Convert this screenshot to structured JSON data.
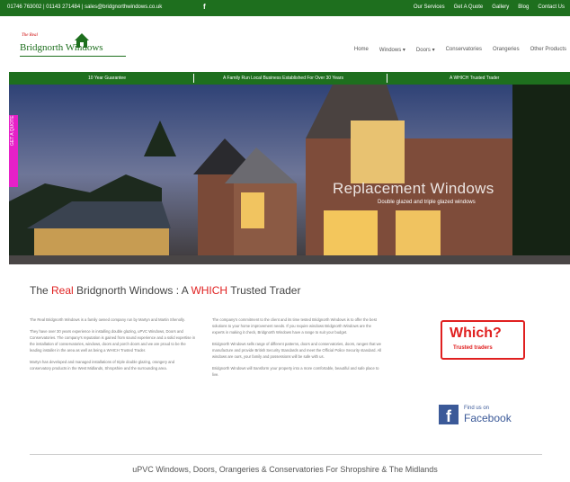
{
  "topbar": {
    "contact": "01746 763002 | 01143 271484 | sales@bridgnorthwindows.co.uk",
    "links": [
      "Our Services",
      "Get A Quote",
      "Gallery",
      "Blog",
      "Contact Us"
    ]
  },
  "header": {
    "logo_small": "The Real",
    "logo_name": "Bridgnorth Windows",
    "nav": [
      "Home",
      "Windows ▾",
      "Doors ▾",
      "Conservatories",
      "Orangeries",
      "Other Products"
    ]
  },
  "usp_bar": [
    "10 Year Guarantee",
    "A Family Run Local Business Established For Over 30 Years",
    "A WHICH Trusted Trader"
  ],
  "hero": {
    "caption": "Replacement Windows",
    "subcaption": "Double glazed and triple glazed windows"
  },
  "quote_tab": "GET A QUOTE",
  "main": {
    "title_prefix": "The ",
    "title_red1": "Real",
    "title_middle": " Bridgnorth Windows : A ",
    "title_red2": "WHICH",
    "title_suffix": " Trusted Trader",
    "col1": [
      "The Real Bridgnorth Windows is a family owned company run by Martyn and Martin Shenolly.",
      "They have over 30 years experience in installing double glazing, uPVC Windows, Doors and Conservatories. The company's reputation is gained from sound experience and a solid expertise in the installation of conservatories, windows, doors and porch doors and we are proud to be the leading installer in the area as well as being a WHICH Trusted Trader.",
      "Martyn has developed and managed installations of triple double glazing, orangery and conservatory products in the West Midlands, Shropshire and the surrounding area."
    ],
    "col2": [
      "The company's commitment to the client and its time tested Bridgnorth Windows is to offer the best solutions to your home improvement needs. If you require windows Bridgnorth Windows are the experts in making it check, Bridgnorth Windows have a range to suit your budget.",
      "Bridgnorth Windows sells range of different patterns, doors and conservatories, doors, ranges that we manufacture and provide British Security Standards and meet the Official Police Security standard. All windows are ours, your family and possessions will be safe with us.",
      "Bridgnorth Windows will transform your property into a more comfortable, beautiful and safe place to live."
    ]
  },
  "badges": {
    "which_title": "Which?",
    "which_sub": "Trusted traders",
    "fb_find": "Find us on",
    "fb_name": "Facebook",
    "fb_letter": "f"
  },
  "footer_line": "uPVC Windows, Doors, Orangeries & Conservatories For Shropshire & The Midlands",
  "colors": {
    "brand_green": "#1e6f1e",
    "accent_red": "#e02020",
    "quote_pink": "#e620c8",
    "facebook_blue": "#3b5998"
  }
}
